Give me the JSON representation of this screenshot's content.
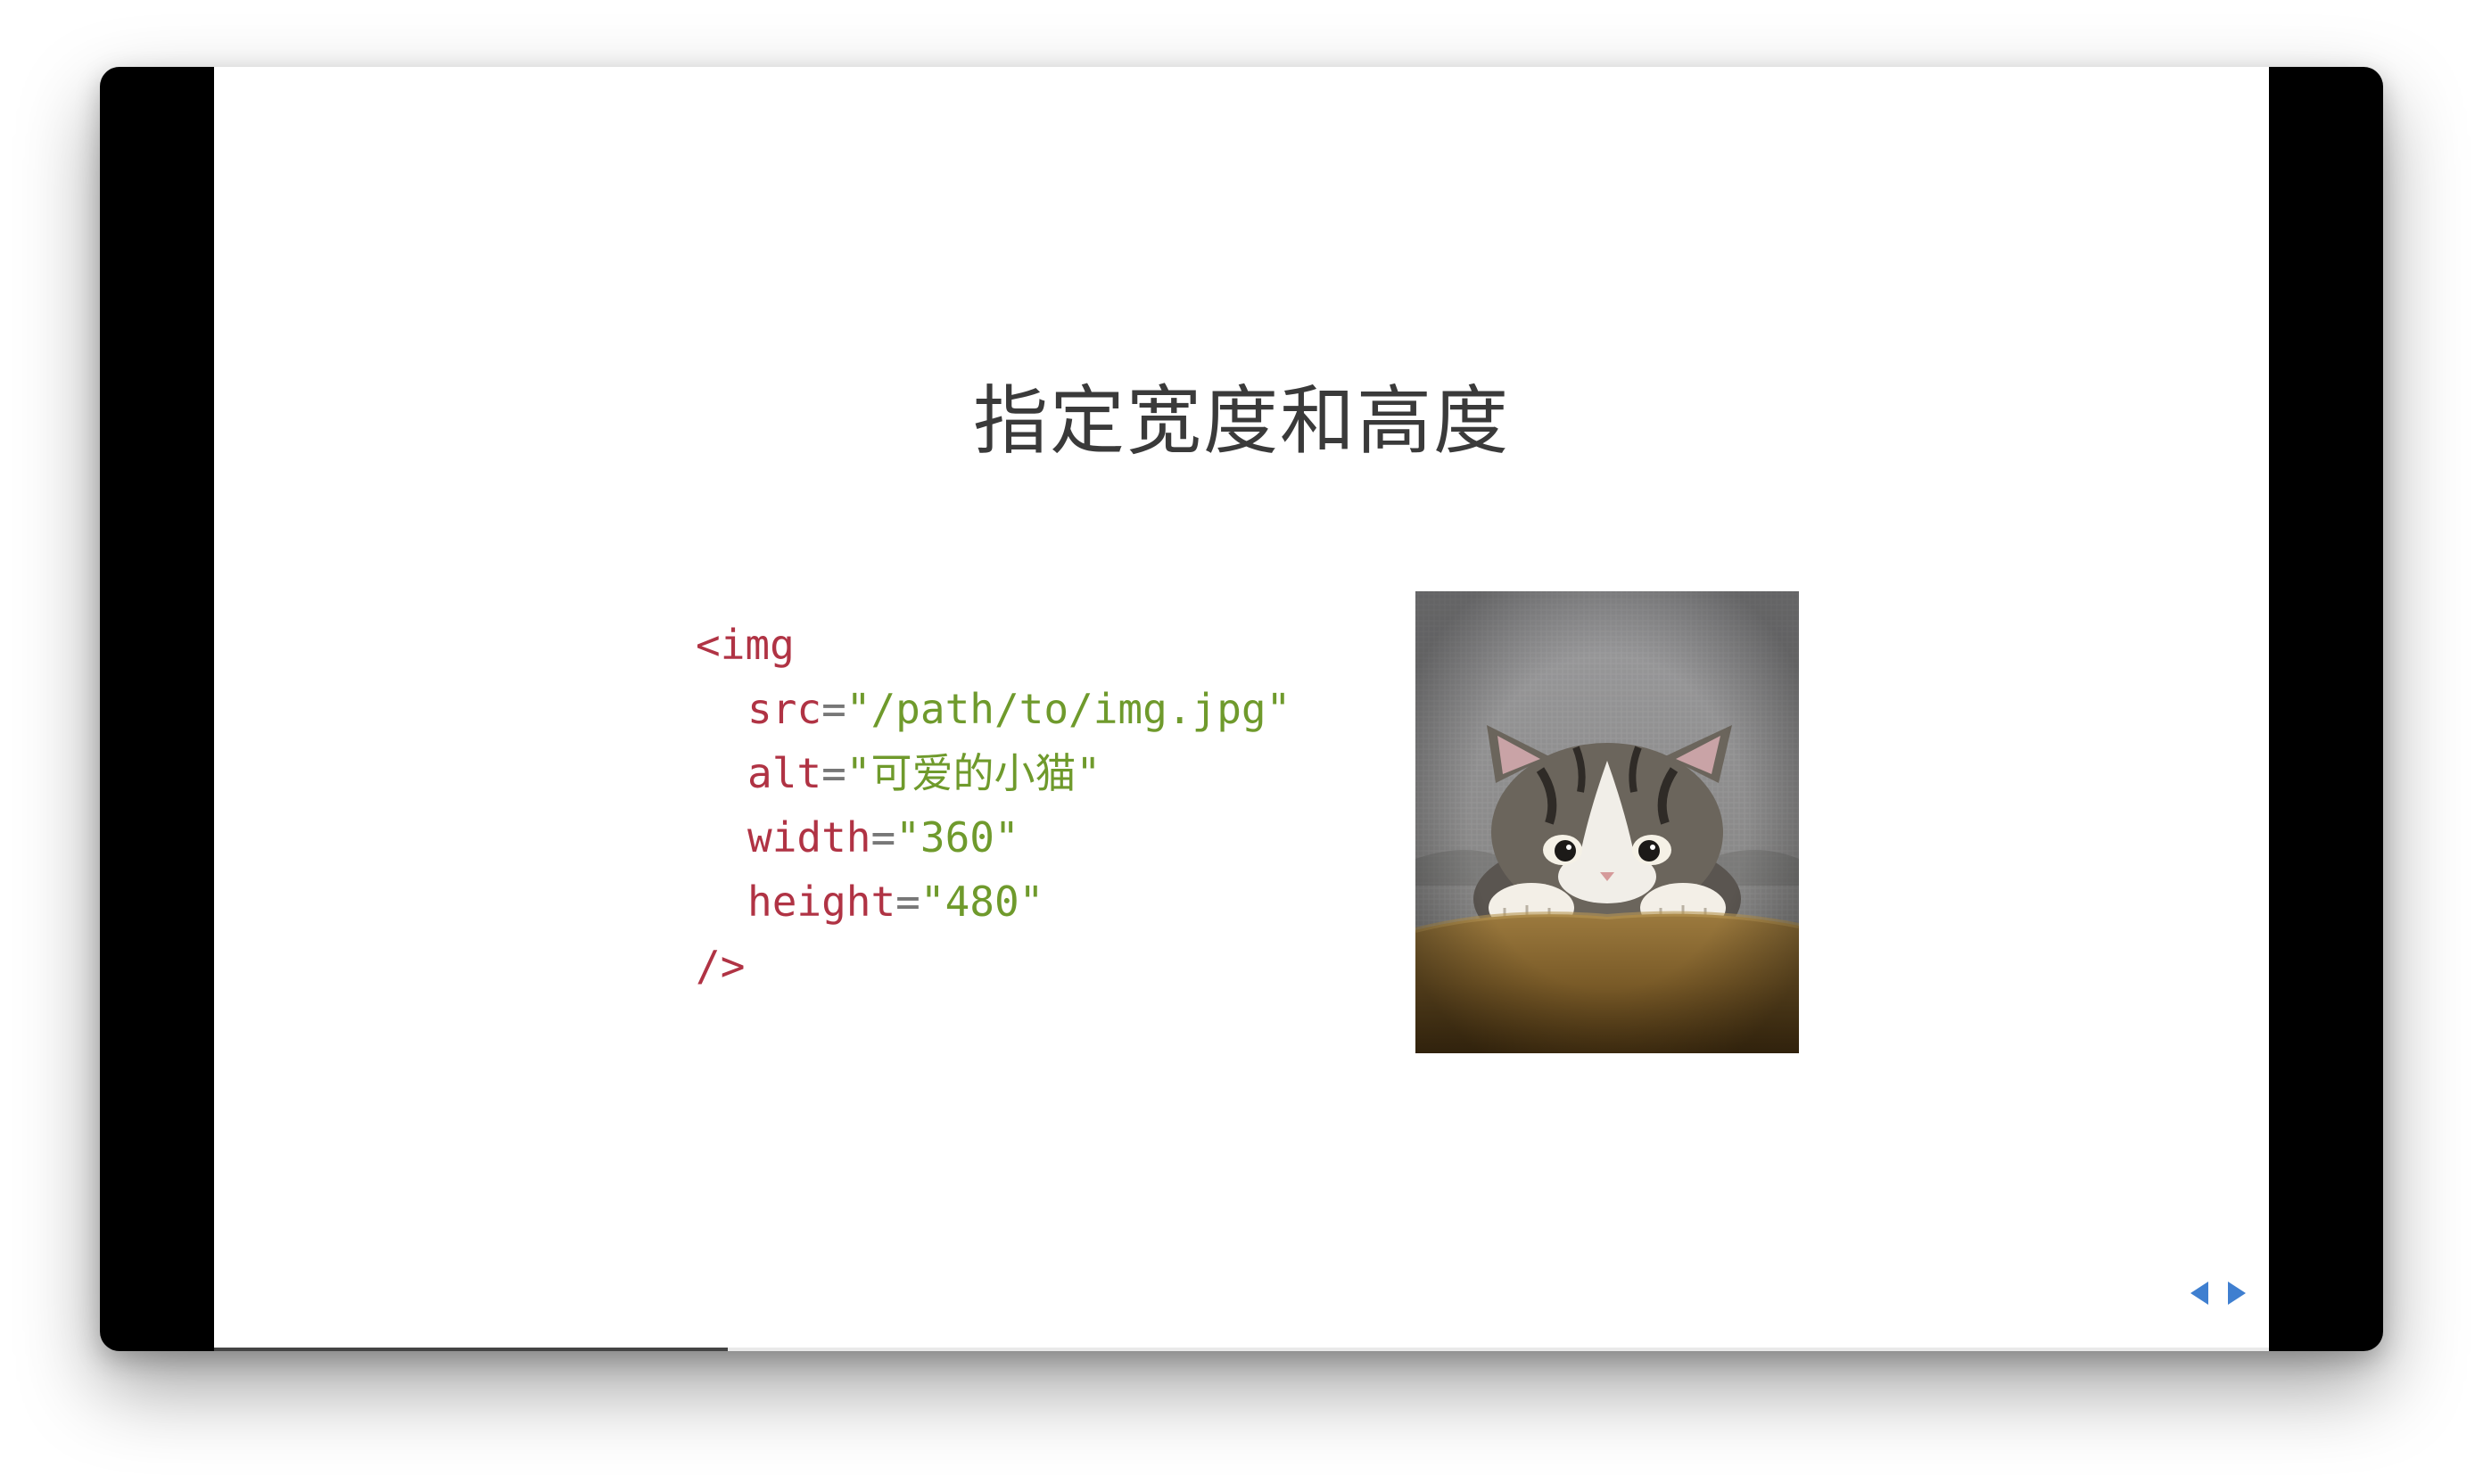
{
  "slide": {
    "title": "指定宽度和高度",
    "code": {
      "open_tag": "<img",
      "attrs": [
        {
          "name": "src",
          "eq": "=",
          "value": "\"/path/to/img.jpg\""
        },
        {
          "name": "alt",
          "eq": "=",
          "value": "\"可爱的小猫\""
        },
        {
          "name": "width",
          "eq": "=",
          "value": "\"360\""
        },
        {
          "name": "height",
          "eq": "=",
          "value": "\"480\""
        }
      ],
      "close_tag": "/>"
    },
    "image": {
      "subject": "kitten peeking over sofa"
    }
  },
  "navigation": {
    "prev_icon": "triangle-left-icon",
    "next_icon": "triangle-right-icon",
    "accent_color": "#3f7fd0"
  },
  "progress": {
    "fraction": 0.25
  },
  "colors": {
    "code_tag": "#b03344",
    "code_string": "#6f9a2c",
    "title_text": "#3a3a3a"
  }
}
